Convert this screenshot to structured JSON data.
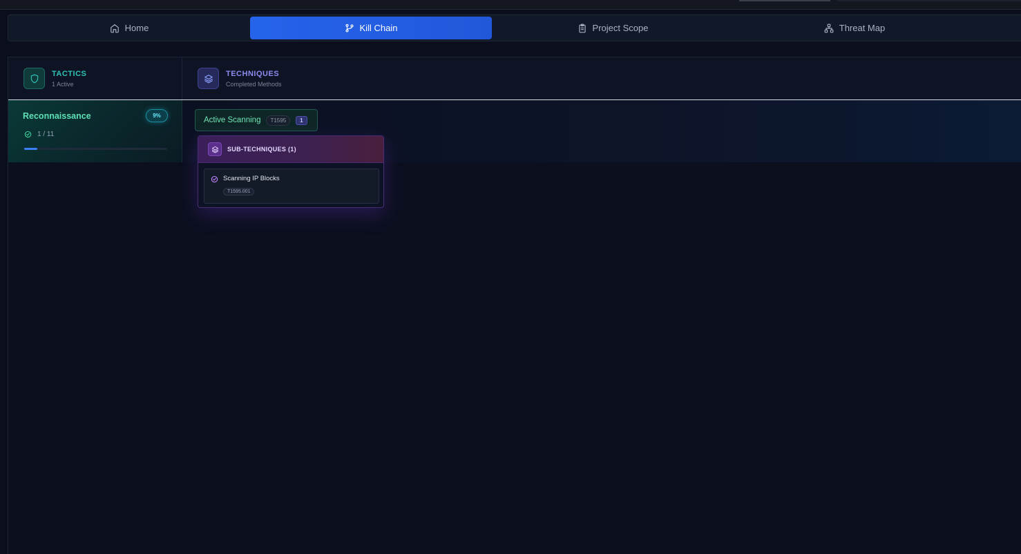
{
  "tabs": [
    {
      "label": "Home",
      "icon": "home-icon",
      "active": false
    },
    {
      "label": "Kill Chain",
      "icon": "git-branch-icon",
      "active": true
    },
    {
      "label": "Project Scope",
      "icon": "clipboard-icon",
      "active": false
    },
    {
      "label": "Threat Map",
      "icon": "network-icon",
      "active": false
    }
  ],
  "tactics_header": {
    "title": "TACTICS",
    "subtitle": "1 Active",
    "icon": "shield-icon"
  },
  "techniques_header": {
    "title": "TECHNIQUES",
    "subtitle": "Completed Methods",
    "icon": "layers-icon"
  },
  "tactic": {
    "name": "Reconnaissance",
    "percent_label": "9%",
    "count_label": "1 / 11",
    "progress_fraction": 0.09
  },
  "technique": {
    "name": "Active Scanning",
    "code": "T1595",
    "count": "1"
  },
  "subtechniques": {
    "header": "SUB-TECHNIQUES (1)",
    "items": [
      {
        "name": "Scanning IP Blocks",
        "code": "T1595.001"
      }
    ]
  },
  "colors": {
    "accent_blue": "#2563eb",
    "teal": "#2ec4b6",
    "indigo": "#8b8cf0",
    "green": "#6ee7b7",
    "purple": "#7c3aed"
  }
}
